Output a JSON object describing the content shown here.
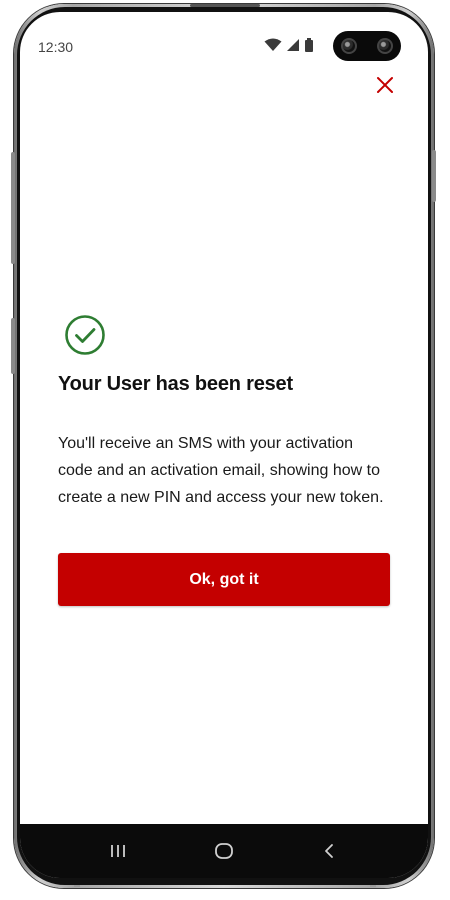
{
  "status_bar": {
    "time": "12:30",
    "icons": [
      "wifi-icon",
      "cellular-signal-icon",
      "battery-icon"
    ]
  },
  "dialog": {
    "close_icon": "close-icon",
    "status_icon": "check-circle-icon",
    "title": "Your User has been reset",
    "message": "You'll receive an SMS with your activation code and an activation email, showing how to create a new PIN and access your new token.",
    "primary_button_label": "Ok, got it"
  },
  "nav_bar": {
    "items": [
      "recent-apps-icon",
      "home-icon",
      "back-icon"
    ]
  },
  "colors": {
    "accent": "#c40000",
    "success": "#2e7d32",
    "close": "#c40000"
  }
}
